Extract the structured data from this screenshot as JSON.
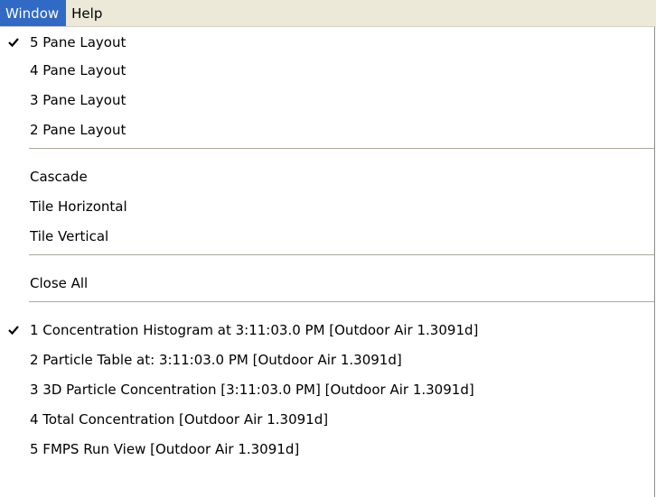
{
  "menubar": {
    "items": [
      {
        "label": "Window",
        "active": true
      },
      {
        "label": "Help",
        "active": false
      }
    ]
  },
  "window_menu": {
    "layout_items": [
      {
        "label": "5 Pane Layout",
        "checked": true
      },
      {
        "label": "4 Pane Layout",
        "checked": false
      },
      {
        "label": "3 Pane Layout",
        "checked": false
      },
      {
        "label": "2 Pane Layout",
        "checked": false
      }
    ],
    "arrange_items": [
      {
        "label": "Cascade"
      },
      {
        "label": "Tile Horizontal"
      },
      {
        "label": "Tile Vertical"
      }
    ],
    "close_all_label": "Close All",
    "window_list": [
      {
        "label": "1 Concentration Histogram at 3:11:03.0 PM  [Outdoor Air 1.3091d]",
        "checked": true
      },
      {
        "label": "2 Particle Table at: 3:11:03.0 PM  [Outdoor Air 1.3091d]",
        "checked": false
      },
      {
        "label": "3 3D Particle Concentration [3:11:03.0 PM]  [Outdoor Air 1.3091d]",
        "checked": false
      },
      {
        "label": "4 Total Concentration  [Outdoor Air 1.3091d]",
        "checked": false
      },
      {
        "label": "5 FMPS Run View  [Outdoor Air 1.3091d]",
        "checked": false
      }
    ]
  },
  "icons": {
    "check": "checkmark-icon"
  },
  "colors": {
    "menubar_bg": "#ece9d8",
    "highlight": "#316ac5",
    "highlight_text": "#ffffff",
    "menu_bg": "#ffffff",
    "separator": "#aca899"
  }
}
